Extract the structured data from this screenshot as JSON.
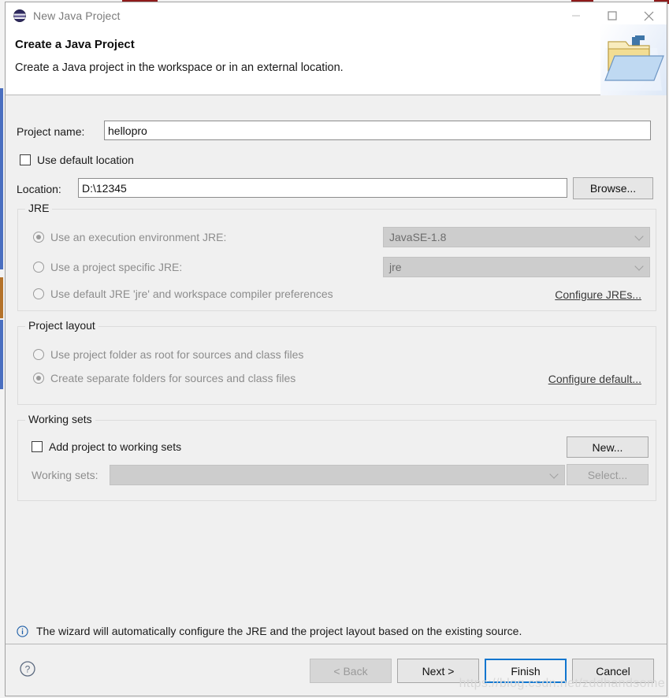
{
  "window": {
    "title": "New Java Project",
    "app_icon": "eclipse-icon",
    "controls": {
      "minimize": "minimize-icon",
      "maximize": "maximize-icon",
      "close": "close-icon"
    }
  },
  "header": {
    "title": "Create a Java Project",
    "description": "Create a Java project in the workspace or in an external location.",
    "banner_icon": "java-project-folder-icon"
  },
  "form": {
    "project_name": {
      "label": "Project name:",
      "value": "hellopro",
      "placeholder": ""
    },
    "use_default_location": {
      "label": "Use default location",
      "checked": false
    },
    "location": {
      "label": "Location:",
      "value": "D:\\12345",
      "placeholder": ""
    },
    "browse_button": "Browse..."
  },
  "jre_group": {
    "title": "JRE",
    "options": [
      {
        "label": "Use an execution environment JRE:",
        "selected": true,
        "enabled": false
      },
      {
        "label": "Use a project specific JRE:",
        "selected": false,
        "enabled": false
      },
      {
        "label": "Use default JRE 'jre' and workspace compiler preferences",
        "selected": false,
        "enabled": false
      }
    ],
    "execution_environment": {
      "value": "JavaSE-1.8",
      "enabled": false
    },
    "project_jre": {
      "value": "jre",
      "enabled": false
    },
    "configure_link": "Configure JREs..."
  },
  "layout_group": {
    "title": "Project layout",
    "options": [
      {
        "label": "Use project folder as root for sources and class files",
        "selected": false,
        "enabled": false
      },
      {
        "label": "Create separate folders for sources and class files",
        "selected": true,
        "enabled": false
      }
    ],
    "configure_link": "Configure default..."
  },
  "working_sets_group": {
    "title": "Working sets",
    "add_checkbox": {
      "label": "Add project to working sets",
      "checked": false,
      "enabled": true
    },
    "combo_label": "Working sets:",
    "combo_value": "",
    "new_button": "New...",
    "select_button": "Select..."
  },
  "info": {
    "icon": "info-icon",
    "message": "The wizard will automatically configure the JRE and the project layout based on the existing source."
  },
  "footer": {
    "help_icon": "help-icon",
    "buttons": [
      {
        "label": "< Back",
        "enabled": false,
        "default": false
      },
      {
        "label": "Next >",
        "enabled": true,
        "default": false
      },
      {
        "label": "Finish",
        "enabled": true,
        "default": true
      },
      {
        "label": "Cancel",
        "enabled": true,
        "default": false
      }
    ]
  },
  "watermark": "https://blog.csdn.net/zddhandsome",
  "colors": {
    "dialog_bg": "#f0f0f0",
    "accent": "#1076cf",
    "disabled_text": "#8d8d8d",
    "info_blue": "#1f5fa8"
  }
}
